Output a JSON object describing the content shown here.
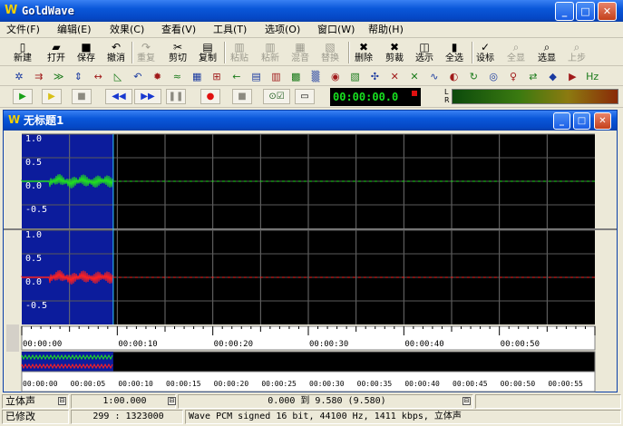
{
  "window": {
    "title": "GoldWave",
    "logo_glyph": "W",
    "minimize_glyph": "_",
    "maximize_glyph": "□",
    "close_glyph": "✕"
  },
  "menu": [
    {
      "id": "file",
      "label": "文件(F)"
    },
    {
      "id": "edit",
      "label": "编辑(E)"
    },
    {
      "id": "effects",
      "label": "效果(C)"
    },
    {
      "id": "view",
      "label": "查看(V)"
    },
    {
      "id": "tools",
      "label": "工具(T)"
    },
    {
      "id": "options",
      "label": "选项(O)"
    },
    {
      "id": "window",
      "label": "窗口(W)"
    },
    {
      "id": "help",
      "label": "帮助(H)"
    }
  ],
  "toolbar": {
    "buttons": [
      {
        "id": "new",
        "label": "新建",
        "icon": "new-file-icon",
        "glyph": "▯",
        "enabled": true
      },
      {
        "id": "open",
        "label": "打开",
        "icon": "open-folder-icon",
        "glyph": "▰",
        "enabled": true
      },
      {
        "id": "save",
        "label": "保存",
        "icon": "save-disk-icon",
        "glyph": "■",
        "enabled": true
      },
      {
        "id": "undo",
        "label": "撤消",
        "icon": "undo-icon",
        "glyph": "↶",
        "enabled": true
      },
      {
        "id": "redo",
        "label": "重复",
        "icon": "redo-icon",
        "glyph": "↷",
        "enabled": false
      },
      {
        "id": "cut",
        "label": "剪切",
        "icon": "scissors-icon",
        "glyph": "✂",
        "enabled": true
      },
      {
        "id": "copy",
        "label": "复制",
        "icon": "copy-icon",
        "glyph": "▤",
        "enabled": true
      },
      {
        "id": "paste",
        "label": "粘贴",
        "icon": "paste-icon",
        "glyph": "▥",
        "enabled": false
      },
      {
        "id": "paste-new",
        "label": "粘新",
        "icon": "paste-new-icon",
        "glyph": "▥",
        "enabled": false
      },
      {
        "id": "mix",
        "label": "混音",
        "icon": "mix-icon",
        "glyph": "▦",
        "enabled": false
      },
      {
        "id": "replace",
        "label": "替换",
        "icon": "replace-icon",
        "glyph": "▧",
        "enabled": false
      },
      {
        "id": "delete",
        "label": "删除",
        "icon": "delete-x-icon",
        "glyph": "✖",
        "enabled": true
      },
      {
        "id": "trim",
        "label": "剪裁",
        "icon": "trim-icon",
        "glyph": "✖",
        "enabled": true
      },
      {
        "id": "select-view",
        "label": "选示",
        "icon": "select-view-icon",
        "glyph": "◫",
        "enabled": true
      },
      {
        "id": "select-all",
        "label": "全选",
        "icon": "select-all-icon",
        "glyph": "▮",
        "enabled": true
      },
      {
        "id": "set-marker",
        "label": "设标",
        "icon": "set-marker-icon",
        "glyph": "✓",
        "enabled": true
      },
      {
        "id": "show-all",
        "label": "全显",
        "icon": "zoom-all-icon",
        "glyph": "⌕",
        "enabled": false
      },
      {
        "id": "show-selection",
        "label": "选显",
        "icon": "zoom-selection-icon",
        "glyph": "⌕",
        "enabled": true
      },
      {
        "id": "previous",
        "label": "上步",
        "icon": "previous-step-icon",
        "glyph": "⌕",
        "enabled": false
      }
    ]
  },
  "effects_toolbar": [
    {
      "icon": "effect-doppler-icon",
      "glyph": "✲"
    },
    {
      "icon": "effect-dynamics-icon",
      "glyph": "⇉"
    },
    {
      "icon": "effect-echo-icon",
      "glyph": "≫"
    },
    {
      "icon": "effect-expand-icon",
      "glyph": "⇕"
    },
    {
      "icon": "effect-fade-icon",
      "glyph": "↔"
    },
    {
      "icon": "effect-fade-in-icon",
      "glyph": "◺"
    },
    {
      "icon": "effect-reverse-icon",
      "glyph": "↶"
    },
    {
      "icon": "effect-filter-icon",
      "glyph": "✹"
    },
    {
      "icon": "effect-flange-icon",
      "glyph": "≈"
    },
    {
      "icon": "effect-equalizer-icon",
      "glyph": "▦"
    },
    {
      "icon": "effect-invert-icon",
      "glyph": "⊞"
    },
    {
      "icon": "effect-offset-icon",
      "glyph": "←"
    },
    {
      "icon": "effect-pan-icon",
      "glyph": "▤"
    },
    {
      "icon": "effect-pitch-icon",
      "glyph": "▥"
    },
    {
      "icon": "effect-resample-icon",
      "glyph": "▩"
    },
    {
      "icon": "effect-spectrum-icon",
      "glyph": "▒"
    },
    {
      "icon": "effect-time-warp-icon",
      "glyph": "◉"
    },
    {
      "icon": "effect-volume-icon",
      "glyph": "▧"
    },
    {
      "icon": "effect-mechanize-icon",
      "glyph": "✣"
    },
    {
      "icon": "effect-silence-icon",
      "glyph": "✕"
    },
    {
      "icon": "effect-noise-icon",
      "glyph": "✕"
    },
    {
      "icon": "effect-smooth-icon",
      "glyph": "∿"
    },
    {
      "icon": "effect-channel-icon",
      "glyph": "◐"
    },
    {
      "icon": "effect-loop-icon",
      "glyph": "↻"
    },
    {
      "icon": "effect-record-icon",
      "glyph": "◎"
    },
    {
      "icon": "effect-bulb-icon",
      "glyph": "♀"
    },
    {
      "icon": "effect-swap-icon",
      "glyph": "⇄"
    },
    {
      "icon": "effect-color-icon",
      "glyph": "◆"
    },
    {
      "icon": "effect-play-icon",
      "glyph": "▶"
    },
    {
      "icon": "effect-hz-icon",
      "glyph": "Hz"
    }
  ],
  "transport": [
    {
      "id": "play",
      "icon": "play-icon",
      "glyph": "▶",
      "color": "#18a018"
    },
    {
      "id": "play-selection",
      "icon": "play-selection-icon",
      "glyph": "▶",
      "color": "#d8c018"
    },
    {
      "id": "stop",
      "icon": "stop-icon",
      "glyph": "■",
      "color": "#8c8a80"
    },
    {
      "id": "rewind",
      "icon": "rewind-icon",
      "glyph": "◀◀",
      "color": "#1838d0"
    },
    {
      "id": "fast-forward",
      "icon": "fast-forward-icon",
      "glyph": "▶▶",
      "color": "#1838d0"
    },
    {
      "id": "pause",
      "icon": "pause-icon",
      "glyph": "❚❚",
      "color": "#8c8a80"
    },
    {
      "id": "record",
      "icon": "record-icon",
      "glyph": "●",
      "color": "#e01010"
    },
    {
      "id": "stop-record",
      "icon": "stop-record-icon",
      "glyph": "■",
      "color": "#8c8a80"
    },
    {
      "id": "control-properties",
      "icon": "control-properties-icon",
      "glyph": "⊙☑",
      "color": "#1a5a1a"
    },
    {
      "id": "window-toggle",
      "icon": "window-toggle-icon",
      "glyph": "▭",
      "color": "#000000"
    }
  ],
  "time_display": "00:00:00.0",
  "level_meter": {
    "label_top": "L",
    "label_bottom": "R"
  },
  "document": {
    "title": "无标题1",
    "logo_glyph": "W"
  },
  "waveform": {
    "channel_top": {
      "labels": [
        "1.0",
        "0.5",
        "0.0",
        "-0.5"
      ],
      "color": "#20e020"
    },
    "channel_bottom": {
      "labels": [
        "1.0",
        "0.5",
        "0.0",
        "-0.5"
      ],
      "color": "#ff2020"
    },
    "selection_color": "#0c1c9c",
    "background": "#000000",
    "selection_end_time": 9.58,
    "total_time": 60,
    "timeline_labels": [
      "00:00:00",
      "00:00:10",
      "00:00:20",
      "00:00:30",
      "00:00:40",
      "00:00:50"
    ],
    "overview_labels": [
      "00:00:00",
      "00:00:05",
      "00:00:10",
      "00:00:15",
      "00:00:20",
      "00:00:25",
      "00:00:30",
      "00:00:35",
      "00:00:40",
      "00:00:45",
      "00:00:50",
      "00:00:55"
    ]
  },
  "status": {
    "channels": "立体声",
    "duration": "1:00.000",
    "selection": "0.000 到 9.580 (9.580)",
    "modified": "已修改",
    "position": "299 : 1323000",
    "format": "Wave PCM signed 16 bit, 44100 Hz, 1411 kbps, 立体声"
  }
}
